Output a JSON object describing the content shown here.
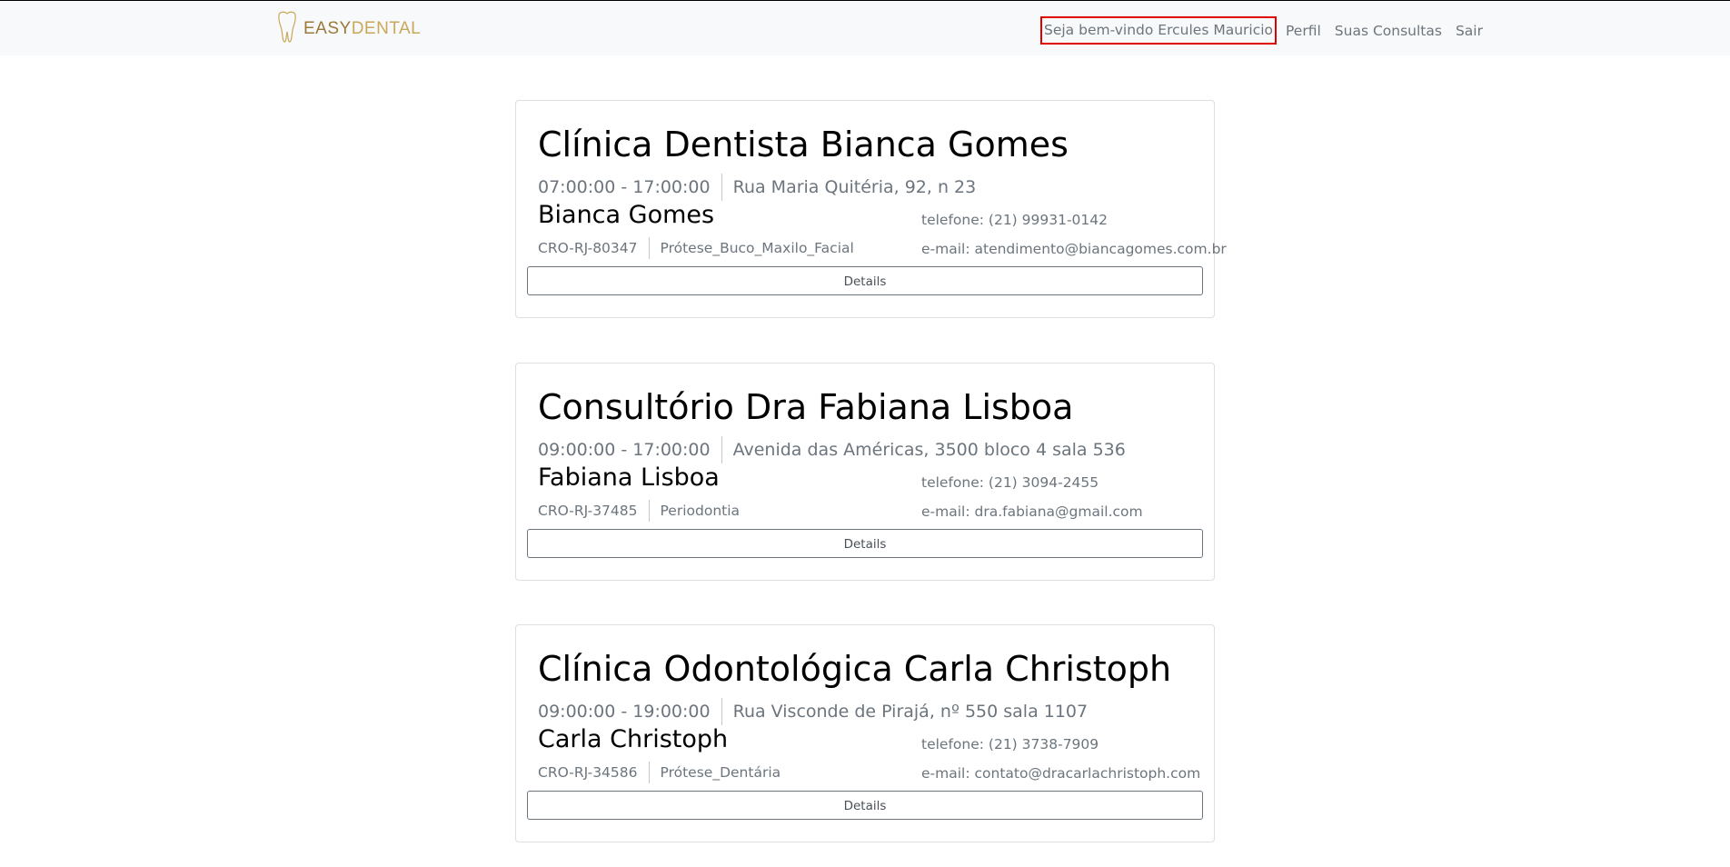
{
  "navbar": {
    "brand": {
      "icon": "tooth-icon",
      "text_part1": "EASY",
      "text_part2": "DENTAL"
    },
    "welcome": "Seja bem-vindo Ercules Mauricio",
    "links": [
      "Perfil",
      "Suas Consultas",
      "Sair"
    ]
  },
  "clinics": [
    {
      "name": "Clínica Dentista Bianca Gomes",
      "hours": "07:00:00 - 17:00:00",
      "address": "Rua Maria Quitéria, 92, n 23",
      "doctor": "Bianca Gomes",
      "cro": "CRO-RJ-80347",
      "specialty": "Prótese_Buco_Maxilo_Facial",
      "phone": "telefone: (21) 99931-0142",
      "email": "e-mail: atendimento@biancagomes.com.br",
      "details_label": "Details"
    },
    {
      "name": "Consultório Dra Fabiana Lisboa",
      "hours": "09:00:00 - 17:00:00",
      "address": "Avenida das Américas, 3500 bloco 4 sala 536",
      "doctor": "Fabiana Lisboa",
      "cro": "CRO-RJ-37485",
      "specialty": "Periodontia",
      "phone": "telefone: (21) 3094-2455",
      "email": "e-mail: dra.fabiana@gmail.com",
      "details_label": "Details"
    },
    {
      "name": "Clínica Odontológica Carla Christoph",
      "hours": "09:00:00 - 19:00:00",
      "address": "Rua Visconde de Pirajá, nº 550 sala 1107",
      "doctor": "Carla Christoph",
      "cro": "CRO-RJ-34586",
      "specialty": "Prótese_Dentária",
      "phone": "telefone: (21) 3738-7909",
      "email": "e-mail: contato@dracarlachristoph.com",
      "details_label": "Details"
    }
  ]
}
